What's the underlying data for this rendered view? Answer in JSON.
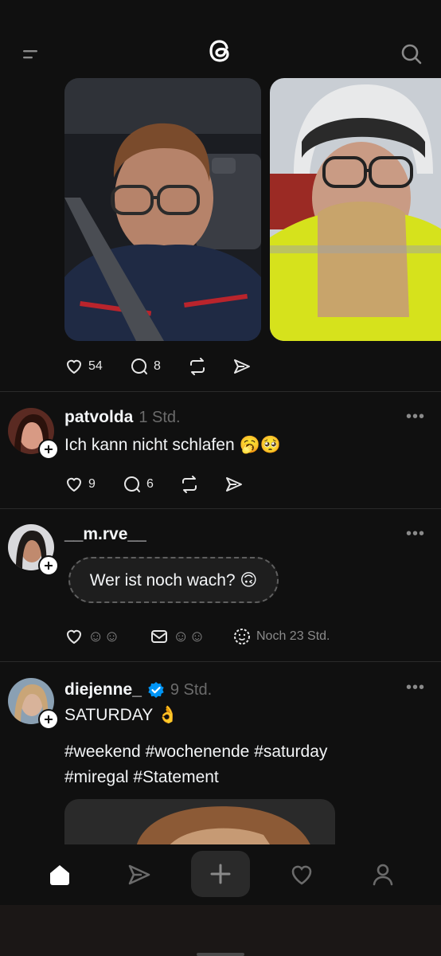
{
  "posts": [
    {
      "stats": {
        "likes": "54",
        "comments": "8"
      }
    },
    {
      "username": "patvolda",
      "time": "1 Std.",
      "text": "Ich kann nicht schlafen 🥱🥺",
      "stats": {
        "likes": "9",
        "comments": "6"
      }
    },
    {
      "username": "__m.rve__",
      "bubble": "Wer ist noch wach? 🙃",
      "reaction_like": "☺☺",
      "reaction_dm": "☺☺",
      "expires": "Noch 23 Std."
    },
    {
      "username": "diejenne_",
      "time": "9 Std.",
      "text": "SATURDAY 👌",
      "hashtags_line1": "#weekend #wochenende #saturday",
      "hashtags_line2": "#miregal #Statement"
    }
  ],
  "header": {
    "logo": "threads-logo",
    "menu_icon": "menu-icon",
    "search_icon": "search-icon"
  },
  "nav": [
    "home-icon",
    "send-icon",
    "create-icon",
    "heart-icon",
    "profile-icon"
  ],
  "colors": {
    "background": "#101010",
    "verified": "#0095f6",
    "accent_yellow": "#d6e21c",
    "muted": "#6b6b6b"
  }
}
